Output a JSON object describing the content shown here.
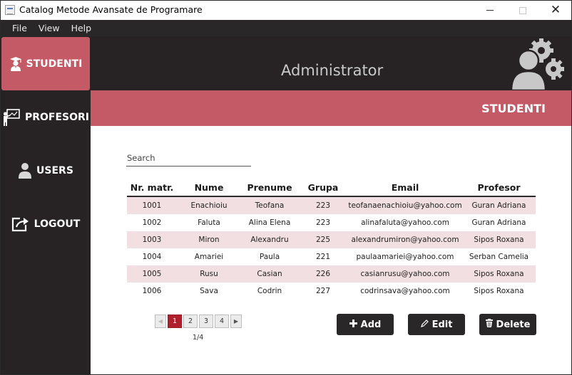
{
  "window": {
    "title": "Catalog Metode Avansate de Programare"
  },
  "menu": {
    "items": [
      "File",
      "View",
      "Help"
    ]
  },
  "sidebar": {
    "items": [
      {
        "label": "STUDENTI",
        "icon": "student-icon",
        "active": true
      },
      {
        "label": "PROFESORI",
        "icon": "teacher-board-icon",
        "active": false
      },
      {
        "label": "USERS",
        "icon": "user-icon",
        "active": false
      },
      {
        "label": "LOGOUT",
        "icon": "logout-icon",
        "active": false
      }
    ]
  },
  "header": {
    "title": "Administrator",
    "icon": "admin-gears-icon"
  },
  "section": {
    "title": "STUDENTI"
  },
  "search": {
    "placeholder": "Search"
  },
  "table": {
    "columns": [
      "Nr. matr.",
      "Nume",
      "Prenume",
      "Grupa",
      "Email",
      "Profesor"
    ],
    "rows": [
      [
        "1001",
        "Enachioiu",
        "Teofana",
        "223",
        "teofanaenachioiu@yahoo.com",
        "Guran Adriana"
      ],
      [
        "1002",
        "Faluta",
        "Alina Elena",
        "223",
        "alinafaluta@yahoo.com",
        "Guran Adriana"
      ],
      [
        "1003",
        "Miron",
        "Alexandru",
        "225",
        "alexandrumiron@yahoo.com",
        "Sipos Roxana"
      ],
      [
        "1004",
        "Amariei",
        "Paula",
        "221",
        "paulaamariei@yahoo.com",
        "Serban Camelia"
      ],
      [
        "1005",
        "Rusu",
        "Casian",
        "226",
        "casianrusu@yahoo.com",
        "Sipos Roxana"
      ],
      [
        "1006",
        "Sava",
        "Codrin",
        "227",
        "codrinsava@yahoo.com",
        "Sipos Roxana"
      ]
    ]
  },
  "pagination": {
    "pages": [
      "1",
      "2",
      "3",
      "4"
    ],
    "current": "1",
    "info": "1/4"
  },
  "actions": {
    "add": "Add",
    "edit": "Edit",
    "delete": "Delete"
  },
  "colors": {
    "accent": "#c45a66",
    "dark": "#272325",
    "row_alt": "#f2dfe1",
    "page_active": "#b01f2c"
  }
}
